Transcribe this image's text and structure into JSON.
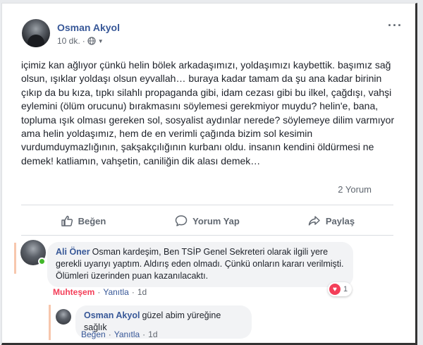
{
  "post": {
    "author": "Osman Akyol",
    "time": "10 dk.",
    "dot": "·",
    "text": "içimiz kan ağlıyor çünkü helin bölek arkadaşımızı, yoldaşımızı kaybettik. başımız sağ olsun, ışıklar yoldaşı olsun eyvallah… buraya kadar tamam da şu ana kadar birinin çıkıp da bu kıza, tıpkı silahlı propaganda gibi, idam cezası gibi bu ilkel, çağdışı, vahşi eylemini (ölüm orucunu) bırakmasını söylemesi gerekmiyor muydu? helin'e, bana, topluma ışık olması gereken sol, sosyalist aydınlar nerede? söylemeye dilim varmıyor ama helin yoldaşımız, hem de en verimli çağında bizim sol kesimin vurdumduymazlığının, şakşakçılığının kurbanı oldu. insanın kendini öldürmesi ne demek! katliamın, vahşetin, caniliğin dik alası demek…",
    "comment_count": "2 Yorum"
  },
  "actions": {
    "like": "Beğen",
    "comment": "Yorum Yap",
    "share": "Paylaş"
  },
  "comments": [
    {
      "author": "Ali Öner",
      "text": "Osman kardeşim, Ben TSİP Genel Sekreteri olarak ilgili yere gerekli uyarıyı yaptım. Aldırış eden olmadı. Çünkü onların kararı verilmişti. Ölümleri üzerinden puan kazanılacaktı.",
      "reaction": "Muhteşem",
      "reply": "Yanıtla",
      "time": "1d",
      "reaction_count": "1"
    },
    {
      "author": "Osman Akyol",
      "text": "güzel abim yüreğine sağlık",
      "reaction": "Beğen",
      "reply": "Yanıtla",
      "time": "1d"
    }
  ],
  "colors": {
    "link": "#385898",
    "love": "#f33e58",
    "online": "#42b72a"
  }
}
